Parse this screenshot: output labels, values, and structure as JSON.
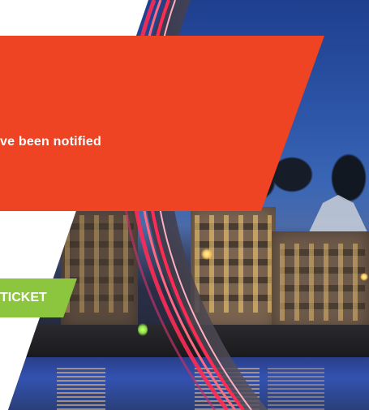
{
  "banner": {
    "message": "ve been notified"
  },
  "ticket_button": {
    "label": "TICKET"
  },
  "colors": {
    "banner": "#ee4423",
    "button": "#8cc63f",
    "text": "#ffffff"
  },
  "background": {
    "scene": "night-cityscape-with-red-light-ring"
  }
}
